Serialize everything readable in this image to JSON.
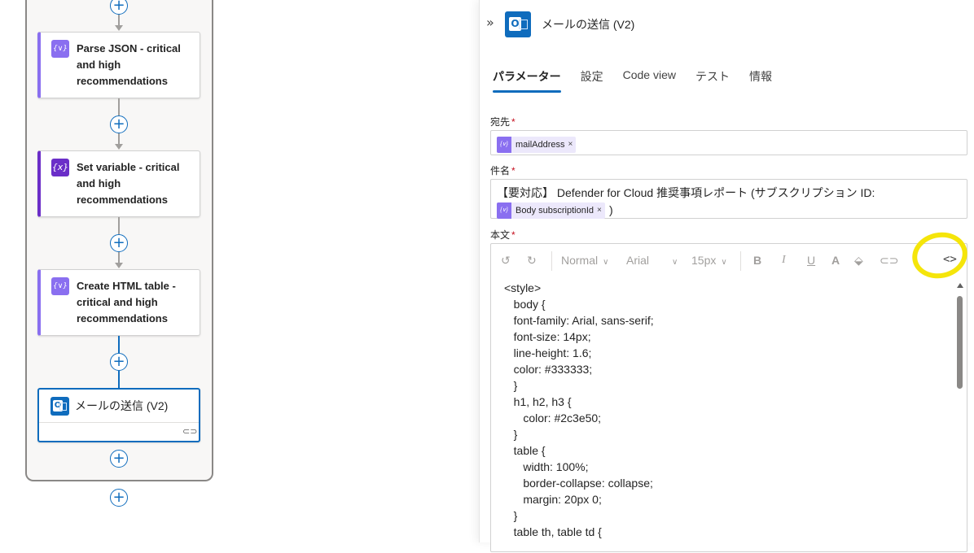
{
  "flow": {
    "cards": [
      {
        "title": "Parse JSON - critical and high recommendations",
        "icon": "{∨}"
      },
      {
        "title": "Set variable - critical and high recommendations",
        "icon": "{x}"
      },
      {
        "title": "Create HTML table - critical and high recommendations",
        "icon": "{∨}"
      },
      {
        "title": "メールの送信 (V2)"
      }
    ],
    "plus_label": "+"
  },
  "panel": {
    "title": "メールの送信 (V2)",
    "tabs": [
      "パラメーター",
      "設定",
      "Code view",
      "テスト",
      "情報"
    ],
    "to": {
      "label": "宛先",
      "required": "*",
      "token": "mailAddress",
      "token_close": "×"
    },
    "subject": {
      "label": "件名",
      "required": "*",
      "text": "【要対応】 Defender for Cloud 推奨事項レポート (サブスクリプション ID:",
      "token": "Body subscriptionId",
      "token_close": "×",
      "suffix": ")"
    },
    "body": {
      "label": "本文",
      "required": "*",
      "toolbar": {
        "style": "Normal",
        "font": "Arial",
        "size": "15px",
        "bold": "B",
        "italic": "I",
        "underline": "U",
        "font_color": "A",
        "code_view": "<>"
      },
      "code_lines": [
        "<style>",
        "   body {",
        "   font-family: Arial, sans-serif;",
        "   font-size: 14px;",
        "   line-height: 1.6;",
        "   color: #333333;",
        "   }",
        "   h1, h2, h3 {",
        "      color: #2c3e50;",
        "   }",
        "   table {",
        "      width: 100%;",
        "      border-collapse: collapse;",
        "      margin: 20px 0;",
        "   }",
        "   table th, table td {"
      ]
    }
  },
  "colors": {
    "accent": "#0f6cbd",
    "variable": "#8a6ff0",
    "highlight": "#f5e50a"
  }
}
